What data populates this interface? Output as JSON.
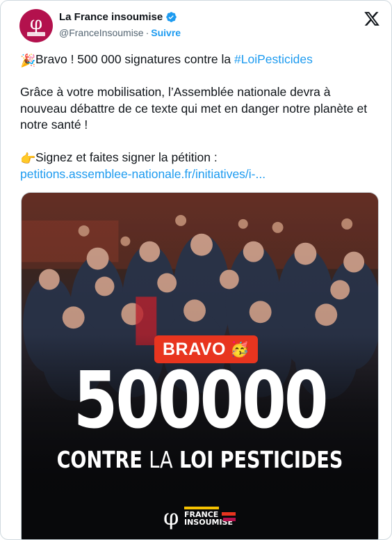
{
  "account": {
    "name": "La France insoumise",
    "handle": "@FranceInsoumise",
    "separator": "·",
    "follow_label": "Suivre",
    "avatar_text": "φ"
  },
  "tweet": {
    "line1_emoji": "🎉",
    "line1_text": "Bravo ! 500 000 signatures contre la ",
    "line1_hashtag": "#LoiPesticides",
    "paragraph2": "Grâce à votre mobilisation, l’Assemblée nationale devra à nouveau débattre de ce texte qui met en danger notre planète et notre santé !",
    "line3_emoji": "👉",
    "line3_text": "Signez et faites signer la pétition :",
    "link": "petitions.assemblee-nationale.fr/initiatives/i-..."
  },
  "media": {
    "badge_text": "BRAVO",
    "badge_emoji": "🥳",
    "big_number": "500000",
    "contre_bold1": "CONTRE",
    "contre_light": "LA",
    "contre_bold2": "LOI PESTICIDES",
    "logo_symbol": "φ",
    "logo_line1": "FRANCE",
    "logo_line2": "INSOUMISE"
  },
  "colors": {
    "accent_blue": "#1d9bf0",
    "badge_red": "#e8351f",
    "avatar_bg": "#b3114d"
  },
  "icons": {
    "verified": "verified-badge-icon",
    "x_logo": "x-logo-icon"
  }
}
